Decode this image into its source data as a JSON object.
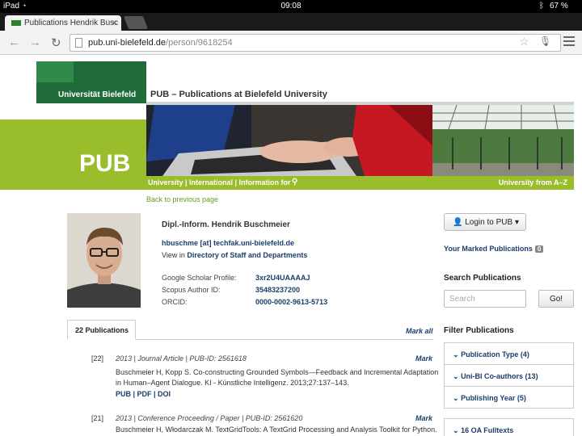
{
  "status_bar": {
    "device": "iPad",
    "time": "09:08",
    "battery": "67 %"
  },
  "browser": {
    "tab_title": "Publications Hendrik Busc",
    "url_host": "pub.uni-bielefeld.de",
    "url_path": "/person/9618254"
  },
  "header": {
    "logo_text": "Universität Bielefeld",
    "site_title": "PUB – Publications at Bielefeld University",
    "brand": "PUB",
    "nav_links": "University | International | Information for",
    "az_link": "University from A–Z",
    "back_link": "Back to previous page"
  },
  "profile": {
    "name": "Dipl.-Inform. Hendrik Buschmeier",
    "email": "hbuschme [at] techfak.uni-bielefeld.de",
    "directory_prefix": "View in",
    "directory_link": "Directory of Staff and Departments",
    "identifiers": [
      {
        "label": "Google Scholar Profile:",
        "value": "3xr2U4UAAAAJ"
      },
      {
        "label": "Scopus Author ID:",
        "value": "35483237200"
      },
      {
        "label": "ORCID:",
        "value": "0000-0002-9613-5713"
      }
    ]
  },
  "publications": {
    "tab_label": "22 Publications",
    "mark_all": "Mark all",
    "items": [
      {
        "num": "[22]",
        "meta": "2013 | Journal Article | PUB-ID: 2561618",
        "mark": "Mark",
        "line1": "Buschmeier H, Kopp S. Co-constructing Grounded Symbols—Feedback and Incremental Adaptation",
        "line2": "in Human–Agent Dialogue. KI - Künstliche Intelligenz. 2013;27:137–143.",
        "links": "PUB | PDF | DOI"
      },
      {
        "num": "[21]",
        "meta": "2013 | Conference Proceeding / Paper | PUB-ID: 2561620",
        "mark": "Mark",
        "line1": "Buschmeier H, Włodarczak M. TextGridTools: A TextGrid Processing and Analysis Toolkit for Python."
      }
    ]
  },
  "sidebar": {
    "login_label": "Login to PUB",
    "marked_label": "Your Marked Publications",
    "marked_count": "0",
    "search_heading": "Search Publications",
    "search_placeholder": "Search",
    "go_label": "Go!",
    "filter_heading": "Filter Publications",
    "filters": [
      "Publication Type (4)",
      "Uni-BI Co-authors (13)",
      "Publishing Year (5)"
    ],
    "oa_label": "16 OA Fulltexts"
  }
}
